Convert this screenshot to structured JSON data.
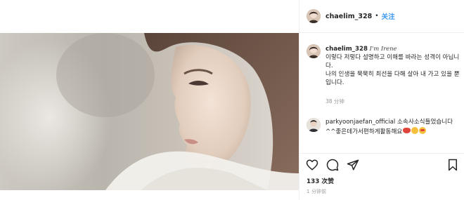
{
  "header": {
    "username": "chaelim_328",
    "separator": "•",
    "follow_label": "关注"
  },
  "caption": {
    "username": "chaelim_328",
    "signature": "I'm Irene",
    "line1": "이렇다 저렇다 설명하고 이해를 바라는 성격이 아닙니다.",
    "line2": "나의 인생을 묵묵히 최선을 다해 살아 내 가고 있을 뿐입니다.",
    "timestamp": "38 分钟"
  },
  "comment": {
    "username": "parkyoonjaefan_official",
    "text": "소속사소식들었습니다^^좋은데가서편하게활동해요"
  },
  "icons": {
    "like": "heart-icon",
    "comment": "comment-icon",
    "share": "share-icon",
    "save": "bookmark-icon"
  },
  "likes": "133 次赞",
  "post_time": "1 分钟前",
  "colors": {
    "accent": "#3897f0",
    "text": "#262626",
    "muted": "#999999"
  }
}
